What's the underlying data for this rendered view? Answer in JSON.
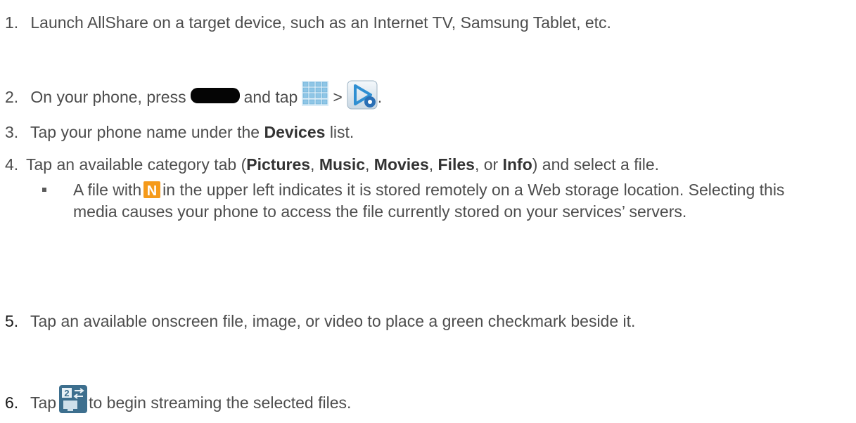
{
  "steps": [
    {
      "num": "1.",
      "text": "Launch AllShare on a target device, such as an Internet TV, Samsung Tablet, etc."
    },
    {
      "num": "2.",
      "a": "On your phone, press",
      "b": "and tap",
      "c": ">",
      "d": "."
    },
    {
      "num": "3.",
      "a": "Tap your phone name under the",
      "bold": "Devices",
      "b": "list."
    },
    {
      "num": "4.",
      "a": "Tap an available category tab (",
      "pictures": "Pictures",
      "music": "Music",
      "movies": "Movies",
      "files": "Files",
      "or": ", or",
      "info": "Info",
      "end": ") and select a file.",
      "comma": ","
    },
    {
      "num": "5.",
      "text": "Tap an available onscreen file, image, or video to place a green checkmark beside it."
    },
    {
      "num": "6.",
      "a": "Tap",
      "b": "to begin streaming the selected files."
    }
  ],
  "bullet": {
    "a": "A file with",
    "b": "in the upper left indicates it is stored remotely on a Web storage location. Selecting this media causes your phone to access the file currently stored on your services’ servers."
  },
  "icons": {
    "home_key": "home-key-icon",
    "apps": "apps-grid-icon",
    "allshare": "allshare-icon",
    "remote_storage": "n-remote-storage-icon",
    "stream": "stream-files-icon",
    "n_letter": "N",
    "stream_digit": "2"
  },
  "colors": {
    "text": "#4d4d4d",
    "n_badge": "#f59a1a",
    "stream_badge": "#3d6f8e"
  }
}
